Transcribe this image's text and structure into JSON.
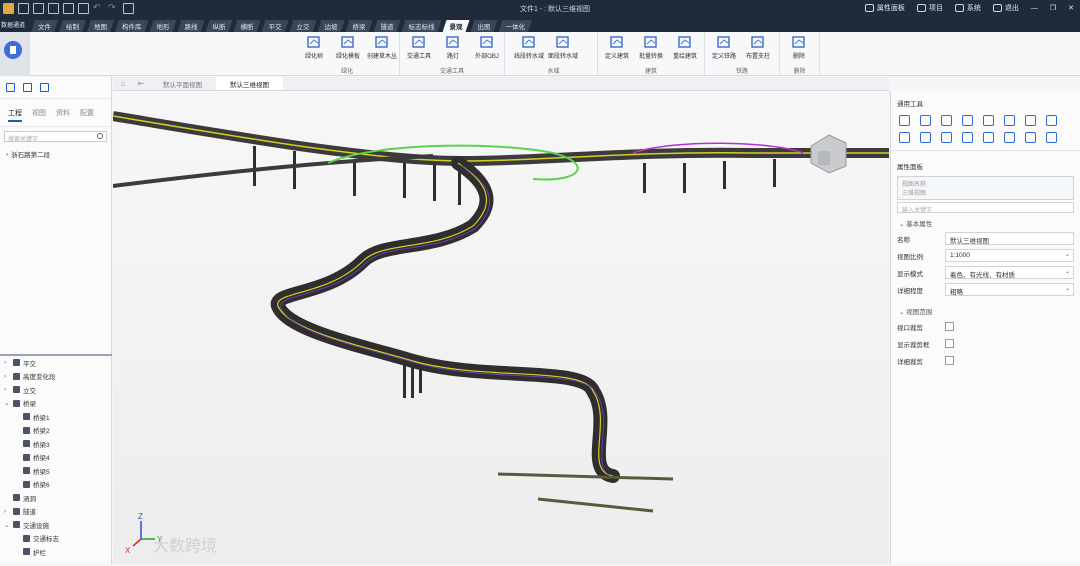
{
  "window": {
    "title": "文件1 - : 默认三维视图",
    "user_label": "退出",
    "props_label": "属性面板",
    "project_label": "项目",
    "system_label": "系统"
  },
  "tabs": [
    "数据通道",
    "文件",
    "绘制",
    "地图",
    "构件库",
    "地形",
    "路线",
    "纵断",
    "横断",
    "平交",
    "立交",
    "边坡",
    "桥梁",
    "隧道",
    "标志标线",
    "景观",
    "出图",
    "一体化"
  ],
  "active_tab": "景观",
  "ribbon": {
    "groups": [
      {
        "label": "绿化",
        "buttons": [
          "绿化树",
          "绿化模板",
          "创建草木丛"
        ]
      },
      {
        "label": "交通工具",
        "buttons": [
          "交通工具",
          "路灯",
          "外部OBJ"
        ]
      },
      {
        "label": "水域",
        "buttons": [
          "线段转水域",
          "面段转水域"
        ]
      },
      {
        "label": "建筑",
        "buttons": [
          "定义建筑",
          "批量转换",
          "重绘建筑"
        ]
      },
      {
        "label": "铁路",
        "buttons": [
          "定义铁路",
          "布置支柱"
        ]
      },
      {
        "label": "删除",
        "buttons": [
          "删除"
        ]
      }
    ]
  },
  "sidebar": {
    "tabs": [
      "工程",
      "视图",
      "资料",
      "配置"
    ],
    "active": "工程",
    "search_placeholder": "搜索关键字",
    "tree_root": "浙石路第二段",
    "lower": [
      {
        "label": "平交",
        "level": 0,
        "arrow": ">"
      },
      {
        "label": "高度变化段",
        "level": 0,
        "arrow": ">"
      },
      {
        "label": "立交",
        "level": 0,
        "arrow": ">"
      },
      {
        "label": "桥梁",
        "level": 0,
        "arrow": "v"
      },
      {
        "label": "桥梁1",
        "level": 1,
        "arrow": ""
      },
      {
        "label": "桥梁2",
        "level": 1,
        "arrow": ""
      },
      {
        "label": "桥梁3",
        "level": 1,
        "arrow": ""
      },
      {
        "label": "桥梁4",
        "level": 1,
        "arrow": ""
      },
      {
        "label": "桥梁5",
        "level": 1,
        "arrow": ""
      },
      {
        "label": "桥梁6",
        "level": 1,
        "arrow": ""
      },
      {
        "label": "涵洞",
        "level": 0,
        "arrow": ""
      },
      {
        "label": "隧道",
        "level": 0,
        "arrow": ">"
      },
      {
        "label": "交通设施",
        "level": 0,
        "arrow": "v"
      },
      {
        "label": "交通标志",
        "level": 1,
        "arrow": ""
      },
      {
        "label": "护栏",
        "level": 1,
        "arrow": ""
      }
    ]
  },
  "doc_tabs": [
    "默认平面视图",
    "默认三维视图"
  ],
  "active_doc": "默认三维视图",
  "right_panel": {
    "tools_title": "通用工具",
    "props_title": "属性面板",
    "view_name_box": "视图名称\n三维视图",
    "search_placeholder": "输入关键字",
    "section_basic": "基本属性",
    "props": [
      {
        "k": "名称",
        "v": "默认三维视图",
        "dd": false
      },
      {
        "k": "视图比例",
        "v": "1:1000",
        "dd": true
      },
      {
        "k": "显示模式",
        "v": "着色、有光线、有材质",
        "dd": true
      },
      {
        "k": "详细程度",
        "v": "粗略",
        "dd": true
      }
    ],
    "section_range": "视图范围",
    "checks": [
      "视口裁剪",
      "显示裁剪框",
      "详细裁剪"
    ]
  },
  "watermark": "大数跨境",
  "axes": {
    "x": "X",
    "y": "Y",
    "z": "Z"
  }
}
